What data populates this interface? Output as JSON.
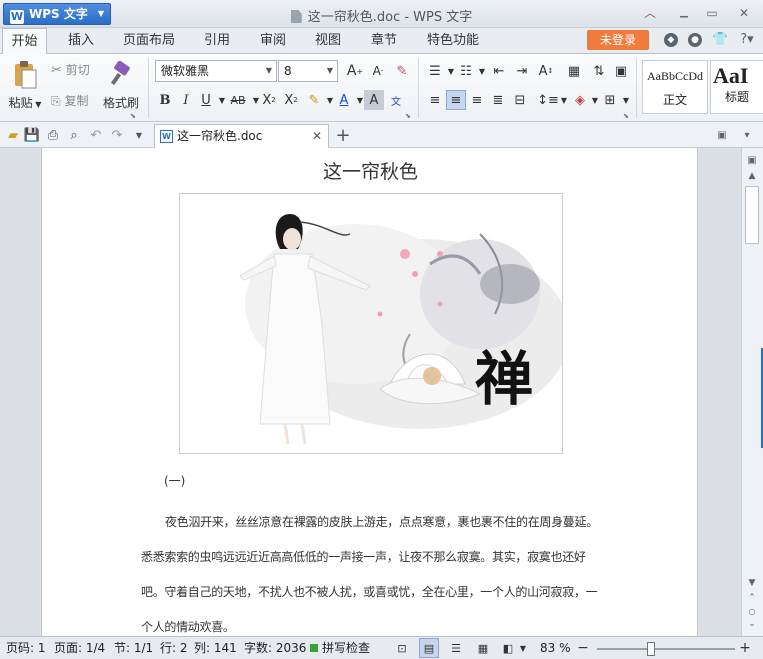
{
  "app": {
    "menu_label": "WPS 文字",
    "logo_letter": "W",
    "window_title": "这一帘秋色.doc - WPS 文字"
  },
  "window_controls": {
    "collapse": "︿",
    "restore": "▭",
    "close": "✕"
  },
  "menu_tabs": [
    "开始",
    "插入",
    "页面布局",
    "引用",
    "审阅",
    "视图",
    "章节",
    "特色功能"
  ],
  "login_label": "未登录",
  "ribbon": {
    "paste_label": "粘贴",
    "cut_label": "剪切",
    "copy_label": "复制",
    "format_painter_label": "格式刷",
    "font_name": "微软雅黑",
    "font_size": "8",
    "style_normal_preview": "AaBbCcDd",
    "style_normal_label": "正文",
    "style_heading_preview": "AaI",
    "style_heading_label": "标题",
    "wen_char": "文"
  },
  "doc_tab": {
    "title": "这一帘秋色.doc",
    "icon_letter": "W"
  },
  "document": {
    "title": "这一帘秋色",
    "section_label": "(一)",
    "paragraph": "夜色泅开来，丝丝凉意在裸露的皮肤上游走，点点寒意，裹也裹不住的在周身蔓延。悉悉索索的虫鸣远远近近高高低低的一声接一声，让夜不那么寂寞。其实，寂寞也还好吧。守着自己的天地，不扰人也不被人扰，或喜或忧，全在心里，一个人的山河寂寂，一个人的情动欢喜。",
    "image_character": "禅"
  },
  "status_bar": {
    "page_code": "页码: 1",
    "pages": "页面: 1/4",
    "section": "节: 1/1",
    "row": "行: 2",
    "column": "列: 141",
    "word_count": "字数: 2036",
    "spell_check": "拼写检查",
    "zoom": "83 %",
    "zoom_level_percent": 83
  },
  "colors": {
    "accent": "#2b6dc6",
    "login": "#ef7b3c",
    "status_green": "#3aa03a"
  }
}
